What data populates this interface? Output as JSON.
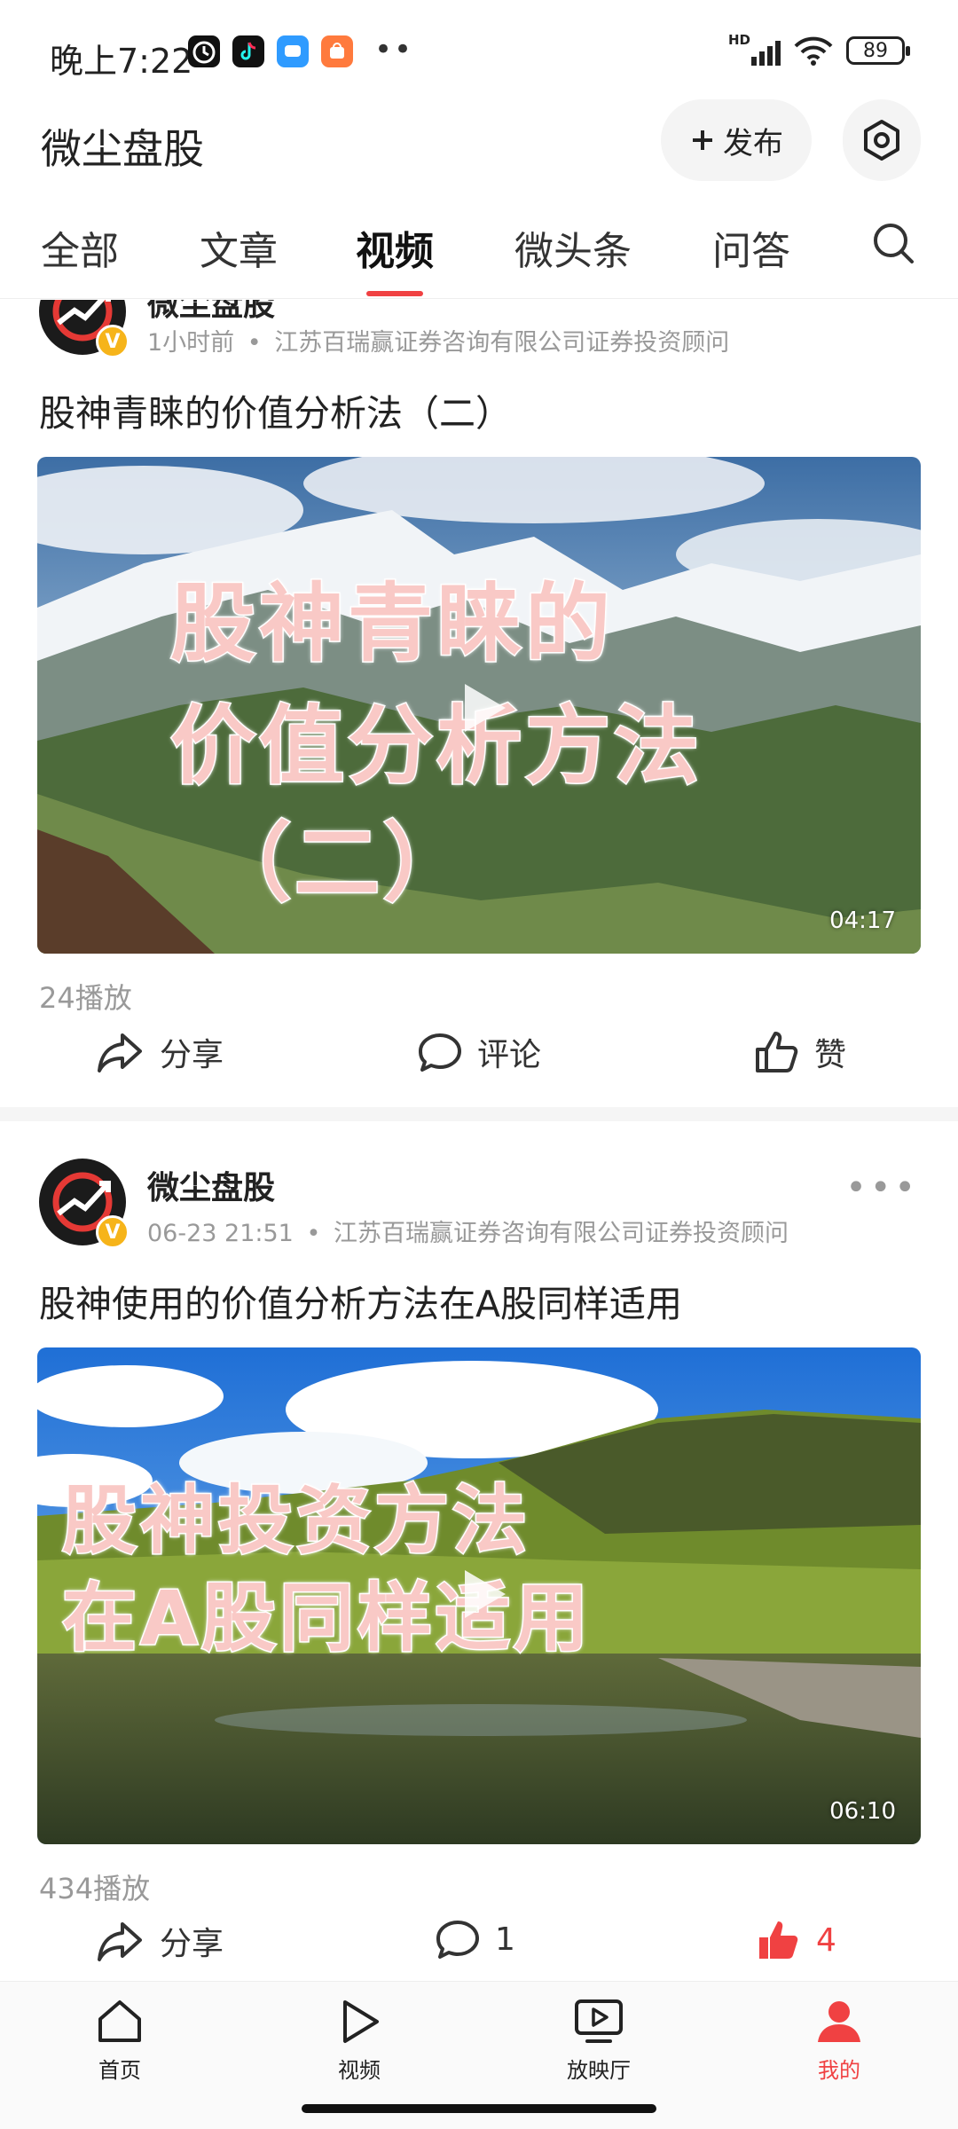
{
  "status_bar": {
    "time": "晚上7:22",
    "dots": "••",
    "network": "HD",
    "battery": "89"
  },
  "header": {
    "title": "微尘盘股",
    "publish_label": "发布"
  },
  "tabs": [
    {
      "label": "全部",
      "active": false
    },
    {
      "label": "文章",
      "active": false
    },
    {
      "label": "视频",
      "active": true
    },
    {
      "label": "微头条",
      "active": false
    },
    {
      "label": "问答",
      "active": false
    }
  ],
  "posts": [
    {
      "author": "微尘盘股",
      "time": "1小时前",
      "separator": "•",
      "credential": "江苏百瑞赢证券咨询有限公司证券投资顾问",
      "title": "股神青睐的价值分析法（二）",
      "overlay_lines": [
        "股神青睐的",
        "价值分析方法",
        "（二）"
      ],
      "duration": "04:17",
      "plays": "24播放",
      "share_label": "分享",
      "comment_label": "评论",
      "like_label": "赞"
    },
    {
      "author": "微尘盘股",
      "time": "06-23 21:51",
      "separator": "•",
      "credential": "江苏百瑞赢证券咨询有限公司证券投资顾问",
      "title": "股神使用的价值分析方法在A股同样适用",
      "overlay_lines": [
        "股神投资方法",
        "在A股同样适用"
      ],
      "duration": "06:10",
      "plays": "434播放",
      "share_label": "分享",
      "comment_count": "1",
      "like_count": "4"
    }
  ],
  "bottom_nav": [
    {
      "label": "首页",
      "icon": "home-icon",
      "active": false
    },
    {
      "label": "视频",
      "icon": "video-play-icon",
      "active": false
    },
    {
      "label": "放映厅",
      "icon": "screening-hall-icon",
      "active": false
    },
    {
      "label": "我的",
      "icon": "profile-icon",
      "active": true
    }
  ],
  "colors": {
    "accent": "#f04142",
    "badge": "#f6b41a"
  }
}
